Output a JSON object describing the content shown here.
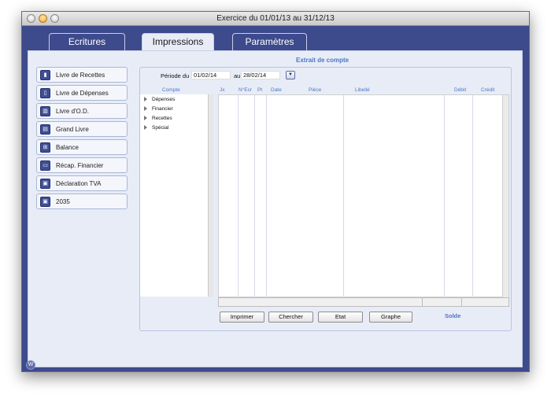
{
  "window": {
    "title": "Exercice du 01/01/13 au 31/12/13"
  },
  "tabs": [
    {
      "label": "Ecritures"
    },
    {
      "label": "Impressions"
    },
    {
      "label": "Paramètres"
    }
  ],
  "sidebar": {
    "items": [
      {
        "label": "Livre de Recettes",
        "icon": "ledger-icon"
      },
      {
        "label": "Livre de Dépenses",
        "icon": "ledger-icon"
      },
      {
        "label": "Livre d'O.D.",
        "icon": "open-book-icon"
      },
      {
        "label": "Grand Livre",
        "icon": "book-icon"
      },
      {
        "label": "Balance",
        "icon": "balance-icon"
      },
      {
        "label": "Récap. Financier",
        "icon": "monitor-icon"
      },
      {
        "label": "Déclaration TVA",
        "icon": "document-icon"
      },
      {
        "label": "2035",
        "icon": "document-icon"
      }
    ]
  },
  "panel": {
    "title": "Extrait de compte",
    "period_label": "Période du",
    "period_from": "01/02/14",
    "period_to_label": "au",
    "period_to": "28/02/14"
  },
  "tree": {
    "header": "Compte",
    "items": [
      "Dépenses",
      "Financier",
      "Recettes",
      "Spécial"
    ]
  },
  "table": {
    "columns": [
      "Jx",
      "N°Ecr",
      "Pt",
      "Date",
      "Pièce",
      "Libellé",
      "Débit",
      "Crédit"
    ]
  },
  "buttons": {
    "imprimer": "Imprimer",
    "chercher": "Chercher",
    "etat": "Etat",
    "graphe": "Graphe"
  },
  "solde_label": "Solde",
  "badge": "W",
  "colors": {
    "window_bg": "#3d4a8c",
    "content_bg": "#e8ecf6",
    "accent": "#4a78c8"
  }
}
